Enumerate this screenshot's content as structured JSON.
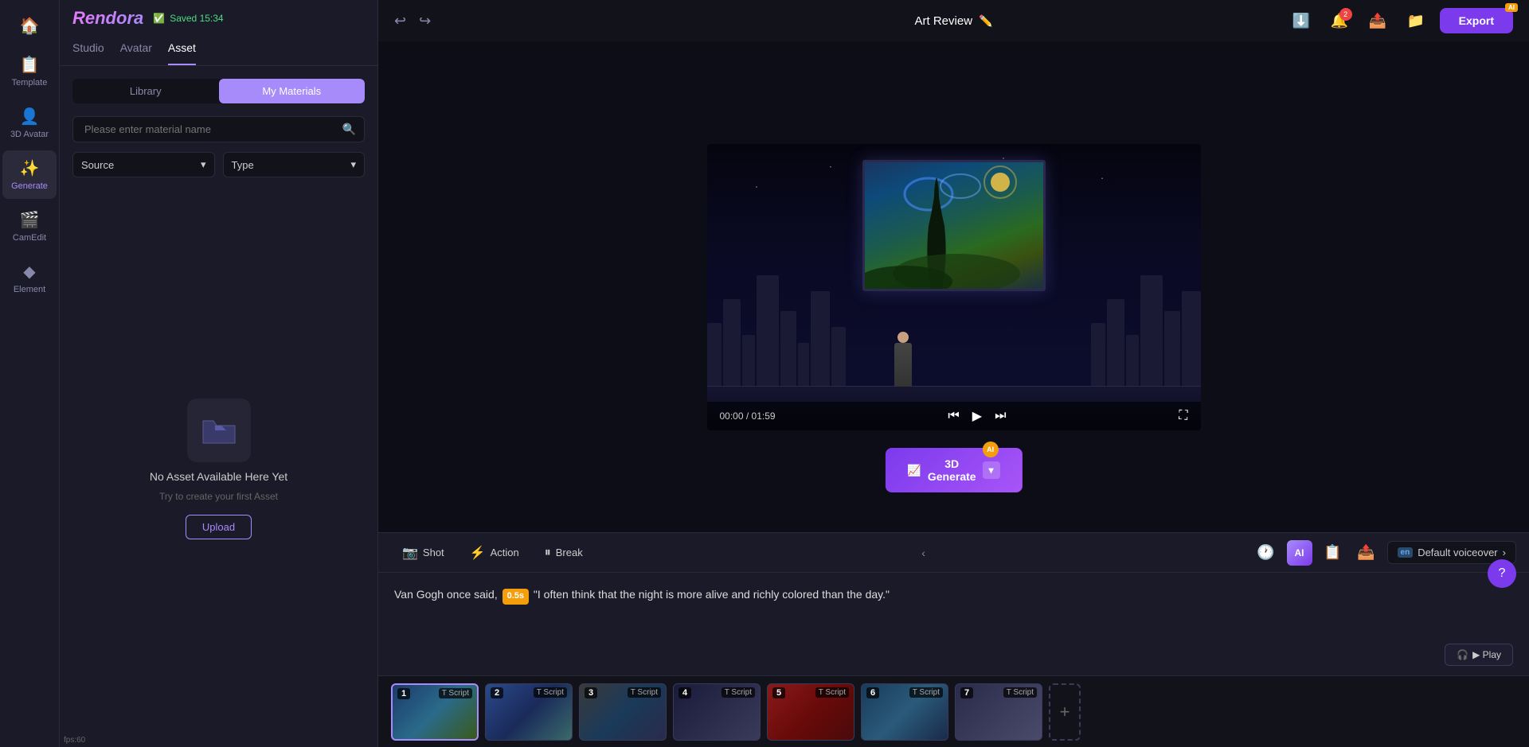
{
  "app": {
    "title": "Rendora",
    "fps": "fps:60"
  },
  "header": {
    "project_title": "Art Review",
    "saved_text": "Saved 15:34",
    "edit_label": "Edit",
    "export_label": "Export",
    "notifications_count": "2"
  },
  "sidebar": {
    "items": [
      {
        "id": "home",
        "label": "Home",
        "icon": "🏠",
        "active": false
      },
      {
        "id": "template",
        "label": "Template",
        "icon": "📋",
        "active": false
      },
      {
        "id": "avatar",
        "label": "3D Avatar",
        "icon": "👤",
        "active": false
      },
      {
        "id": "generate",
        "label": "Generate",
        "icon": "✨",
        "active": true
      },
      {
        "id": "camedit",
        "label": "CamEdit",
        "icon": "🎬",
        "active": false
      },
      {
        "id": "element",
        "label": "Element",
        "icon": "◆",
        "active": false
      }
    ]
  },
  "panel": {
    "tabs": [
      "Studio",
      "Avatar",
      "Asset"
    ],
    "active_tab": "Asset",
    "subtabs": [
      "Library",
      "My Materials"
    ],
    "active_subtab": "My Materials",
    "search_placeholder": "Please enter material name",
    "filter_source": "Source",
    "filter_type": "Type",
    "empty_title": "No Asset Available Here Yet",
    "empty_sub": "Try to create your first Asset",
    "upload_label": "Upload"
  },
  "preview": {
    "time_current": "00:00",
    "time_total": "01:59"
  },
  "generate_btn": {
    "label": "3D Generate",
    "icon": "📈"
  },
  "script": {
    "toolbar": {
      "shot_label": "Shot",
      "action_label": "Action",
      "break_label": "Break",
      "voiceover_label": "Default voiceover",
      "voiceover_lang": "en",
      "play_label": "▶ Play"
    },
    "text_before": "Van Gogh once said,",
    "time_tag": "0.5s",
    "text_after": "\"I often think that the night is more alive and richly colored than the day.\""
  },
  "timeline": {
    "clips": [
      {
        "num": "1",
        "label": "T Script",
        "active": true,
        "bg": "clip1-bg"
      },
      {
        "num": "2",
        "label": "T Script",
        "active": false,
        "bg": "clip2-bg"
      },
      {
        "num": "3",
        "label": "T Script",
        "active": false,
        "bg": "clip3-bg"
      },
      {
        "num": "4",
        "label": "T Script",
        "active": false,
        "bg": "clip4-bg"
      },
      {
        "num": "5",
        "label": "T Script",
        "active": false,
        "bg": "clip5-bg"
      },
      {
        "num": "6",
        "label": "T Script",
        "active": false,
        "bg": "clip6-bg"
      },
      {
        "num": "7",
        "label": "T Script",
        "active": false,
        "bg": "clip7-bg"
      }
    ],
    "add_label": "+"
  }
}
